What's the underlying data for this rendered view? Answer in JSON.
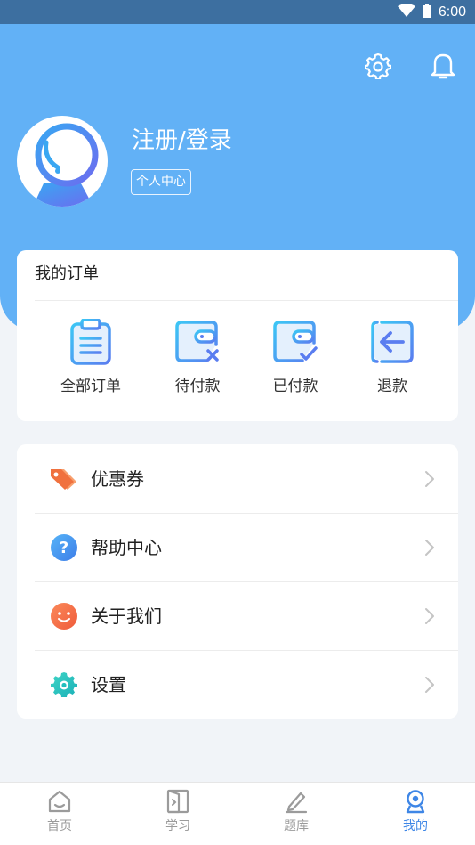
{
  "status_bar": {
    "time": "6:00",
    "wifi_icon": "wifi-icon",
    "battery_icon": "battery-icon"
  },
  "header": {
    "settings_icon": "gear-icon",
    "notification_icon": "bell-icon",
    "user": {
      "name": "注册/登录",
      "tag": "个人中心"
    }
  },
  "orders": {
    "title": "我的订单",
    "items": [
      {
        "label": "全部订单",
        "icon": "clipboard-icon"
      },
      {
        "label": "待付款",
        "icon": "wallet-cancel-icon"
      },
      {
        "label": "已付款",
        "icon": "wallet-check-icon"
      },
      {
        "label": "退款",
        "icon": "refund-arrow-icon"
      }
    ]
  },
  "menu": {
    "items": [
      {
        "label": "优惠券",
        "icon": "coupon-tag-icon"
      },
      {
        "label": "帮助中心",
        "icon": "help-question-icon"
      },
      {
        "label": "关于我们",
        "icon": "smile-face-icon"
      },
      {
        "label": "设置",
        "icon": "settings-gear-icon"
      }
    ]
  },
  "tabbar": {
    "active": "我的",
    "tabs": [
      {
        "label": "首页",
        "icon": "home-icon"
      },
      {
        "label": "学习",
        "icon": "study-door-icon"
      },
      {
        "label": "题库",
        "icon": "pencil-edit-icon"
      },
      {
        "label": "我的",
        "icon": "profile-icon"
      }
    ]
  },
  "colors": {
    "header_blue": "#62b1f6",
    "status_bar": "#3d6fa0",
    "active_tab": "#3e86e6",
    "page_bg": "#f1f4f8"
  }
}
